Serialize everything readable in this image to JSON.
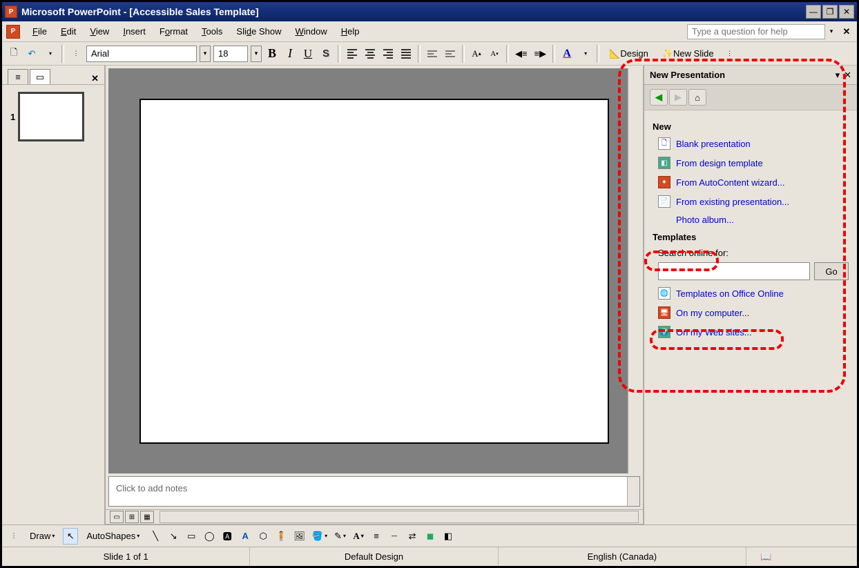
{
  "title": "Microsoft PowerPoint - [Accessible Sales Template]",
  "menus": {
    "file": "File",
    "edit": "Edit",
    "view": "View",
    "insert": "Insert",
    "format": "Format",
    "tools": "Tools",
    "slideshow": "Slide Show",
    "window": "Window",
    "help": "Help"
  },
  "help_placeholder": "Type a question for help",
  "toolbar": {
    "font": "Arial",
    "size": "18",
    "design": "Design",
    "newslide": "New Slide"
  },
  "outline": {
    "slide_number": "1"
  },
  "notes_placeholder": "Click to add notes",
  "taskpane": {
    "title": "New Presentation",
    "section_new": "New",
    "links_new": {
      "blank": "Blank presentation",
      "design": "From design template",
      "wizard": "From AutoContent wizard...",
      "existing": "From existing presentation...",
      "photo": "Photo album..."
    },
    "section_templates": "Templates",
    "search_label": "Search online for:",
    "go": "Go",
    "links_tpl": {
      "online": "Templates on Office Online",
      "computer": "On my computer...",
      "websites": "On my Web sites..."
    }
  },
  "drawbar": {
    "draw": "Draw",
    "autoshapes": "AutoShapes"
  },
  "status": {
    "slide": "Slide 1 of 1",
    "design": "Default Design",
    "lang": "English (Canada)"
  }
}
